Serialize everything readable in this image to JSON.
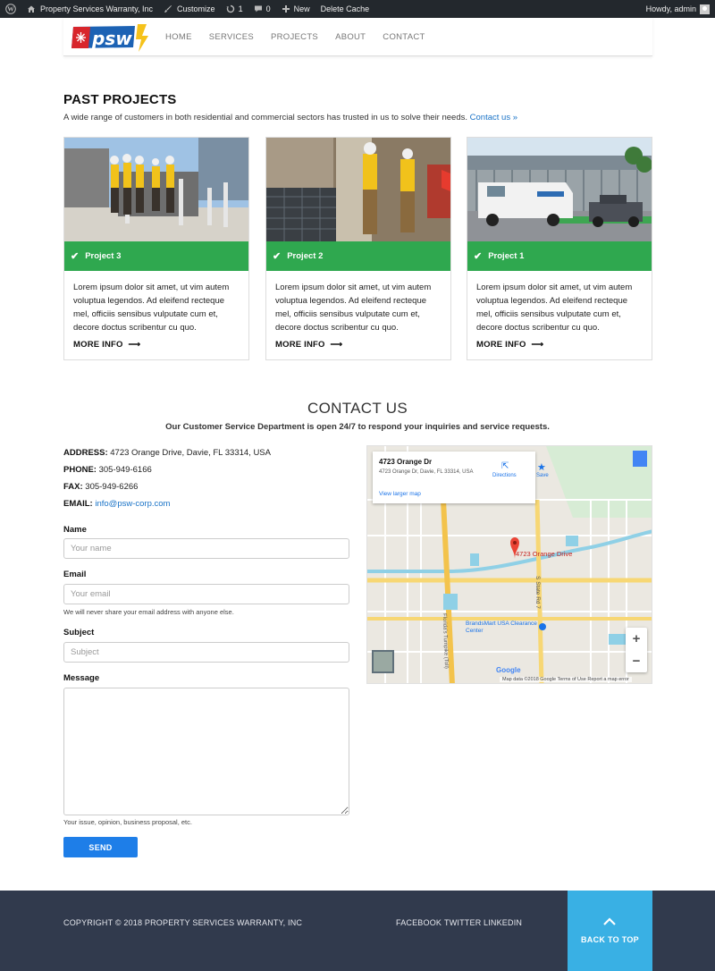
{
  "admin_bar": {
    "site_name": "Property Services Warranty, Inc",
    "customize": "Customize",
    "updates_count": "1",
    "comments_count": "0",
    "new": "New",
    "delete_cache": "Delete Cache",
    "greeting": "Howdy, admin"
  },
  "header": {
    "logo_text": "psw",
    "nav": [
      "HOME",
      "SERVICES",
      "PROJECTS",
      "ABOUT",
      "CONTACT"
    ]
  },
  "projects": {
    "title": "PAST PROJECTS",
    "intro": "A wide range of customers in both residential and commercial sectors has trusted in us to solve their needs.",
    "intro_link": "Contact us »",
    "cards": [
      {
        "name": "Project 3",
        "desc": "Lorem ipsum dolor sit amet, ut vim autem voluptua legendos. Ad eleifend recteque mel, officiis sensibus vulputate cum et, decore doctus scribentur cu quo.",
        "more": "MORE INFO"
      },
      {
        "name": "Project 2",
        "desc": "Lorem ipsum dolor sit amet, ut vim autem voluptua legendos. Ad eleifend recteque mel, officiis sensibus vulputate cum et, decore doctus scribentur cu quo.",
        "more": "MORE INFO"
      },
      {
        "name": "Project 1",
        "desc": "Lorem ipsum dolor sit amet, ut vim autem voluptua legendos. Ad eleifend recteque mel, officiis sensibus vulputate cum et, decore doctus scribentur cu quo.",
        "more": "MORE INFO"
      }
    ]
  },
  "contact": {
    "title": "CONTACT US",
    "subtitle": "Our Customer Service Department is open 24/7 to respond your inquiries and service requests.",
    "address_label": "ADDRESS:",
    "address": "4723 Orange Drive, Davie, FL 33314, USA",
    "phone_label": "PHONE:",
    "phone": "305-949-6166",
    "fax_label": "FAX:",
    "fax": "305-949-6266",
    "email_label": "EMAIL:",
    "email": "info@psw-corp.com"
  },
  "form": {
    "name_label": "Name",
    "name_placeholder": "Your name",
    "email_label": "Email",
    "email_placeholder": "Your email",
    "email_help": "We will never share your email address with anyone else.",
    "subject_label": "Subject",
    "subject_placeholder": "Subject",
    "message_label": "Message",
    "message_help": "Your issue, opinion, business proposal, etc.",
    "send": "SEND"
  },
  "map": {
    "place_title": "4723 Orange Dr",
    "place_address": "4723 Orange Dr, Davie, FL 33314, USA",
    "larger_map": "View larger map",
    "directions": "Directions",
    "save": "Save",
    "pin_label": "4723 Orange Drive",
    "poi_label": "BrandsMart USA Clearance Center",
    "road_label": "Florida's Turnpike (Toll)",
    "state_road_label": "S State Rd 7",
    "attribution": "Map data ©2018 Google   Terms of Use   Report a map error",
    "google": "Google",
    "zoom_in": "+",
    "zoom_out": "−"
  },
  "footer": {
    "copyright": "COPYRIGHT © 2018 PROPERTY SERVICES WARRANTY, INC",
    "social": [
      "FACEBOOK",
      "TWITTER",
      "LINKEDIN"
    ],
    "back_to_top": "BACK TO TOP"
  },
  "colors": {
    "admin_bar": "#23282d",
    "project_bar": "#2fa84f",
    "link": "#1a73c7",
    "send_button": "#1e7ee8",
    "footer": "#313a4d",
    "back_to_top": "#39b0e4"
  }
}
